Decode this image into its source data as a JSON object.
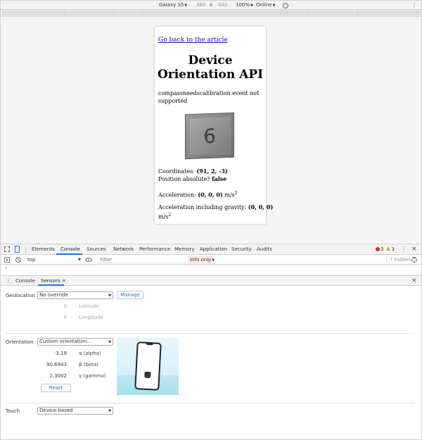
{
  "device_toolbar": {
    "device": "Galaxy S5",
    "width": "360",
    "times": "×",
    "height": "640",
    "zoom": "100%",
    "network": "Online"
  },
  "page": {
    "back_link": "Go back to the article",
    "title": "Device Orientation API",
    "warning": "compassneedscalibration event not supported",
    "cube_label": "6",
    "coordinates_label": "Coordinates: ",
    "coordinates_values": "(91, 2, -3)",
    "position_absolute_label": "Position absolute? ",
    "position_absolute_value": "false",
    "acceleration_label": "Acceleration: ",
    "acceleration_values": "(0, 0, 0)",
    "acceleration_unit": " m/s",
    "acceleration_gravity_label": "Acceleration including gravity: ",
    "acceleration_gravity_values": "(0, 0, 0)",
    "unit_line": "m/s",
    "exponent": "2"
  },
  "devtools": {
    "tabs": [
      "Elements",
      "Console",
      "Sources",
      "Network",
      "Performance",
      "Memory",
      "Application",
      "Security",
      "Audits"
    ],
    "active_tab": "Console",
    "errors": "3",
    "warnings": "3"
  },
  "console_toolbar": {
    "context": "top",
    "filter_placeholder": "Filter",
    "levels": "Info only",
    "hidden": "7 hidden"
  },
  "drawer": {
    "tabs": [
      "Console",
      "Sensors"
    ],
    "active_tab": "Sensors",
    "close_glyph": "×"
  },
  "sensors": {
    "geolocation_label": "Geolocation",
    "geolocation_value": "No override",
    "manage_button": "Manage",
    "latitude_value": "0",
    "latitude_label": "Latitude",
    "longitude_value": "0",
    "longitude_label": "Longitude",
    "orientation_label": "Orientation",
    "orientation_value": "Custom orientation...",
    "alpha_value": "-3.19",
    "alpha_label": "α (alpha)",
    "beta_value": "90.6943",
    "beta_label": "β (beta)",
    "gamma_value": "2.3002",
    "gamma_label": "γ (gamma)",
    "reset_button": "Reset",
    "touch_label": "Touch",
    "touch_value": "Device-based"
  },
  "colors": {
    "accent": "#1a73e8",
    "error": "#d93025",
    "warning": "#e8a200"
  }
}
